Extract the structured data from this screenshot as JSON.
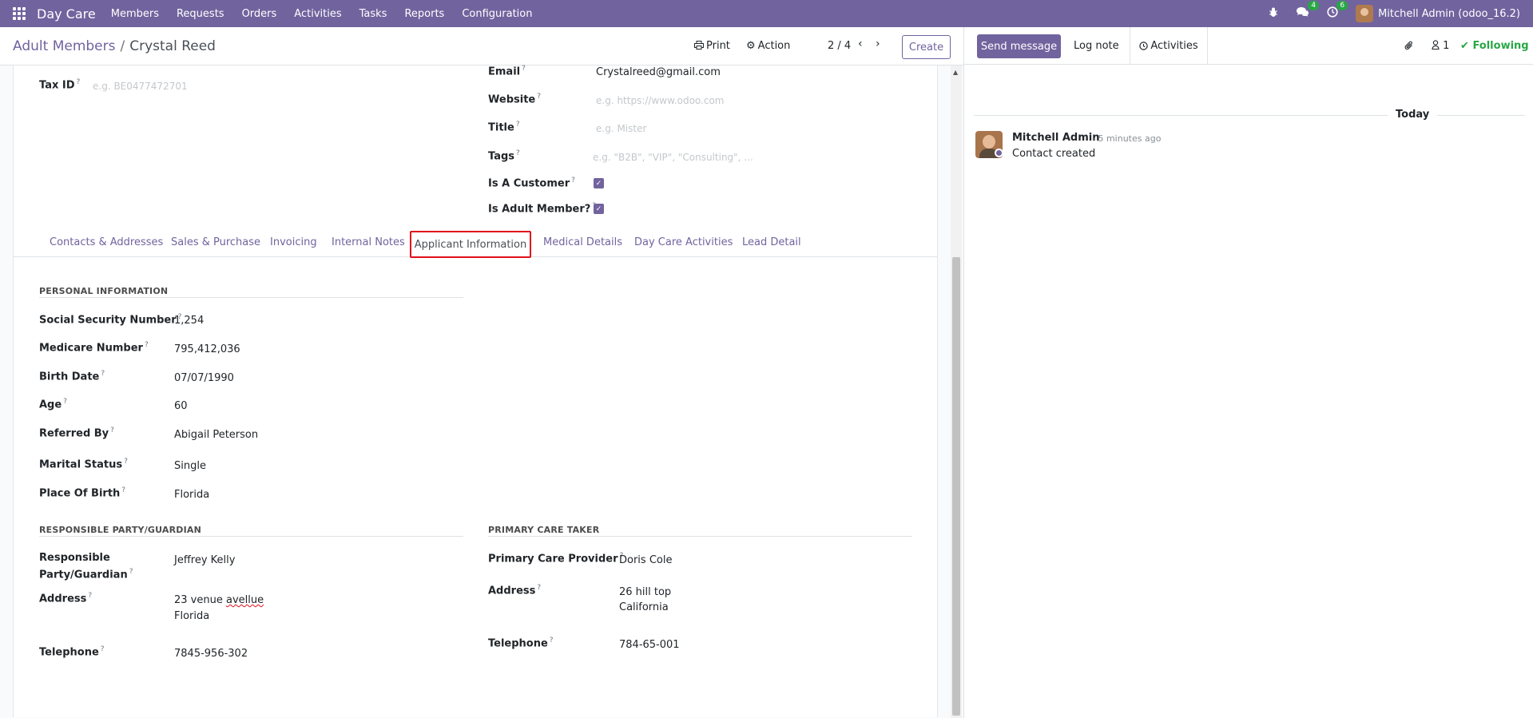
{
  "navbar": {
    "brand": "Day Care",
    "menu": [
      "Members",
      "Requests",
      "Orders",
      "Activities",
      "Tasks",
      "Reports",
      "Configuration"
    ],
    "messages_count": "4",
    "activities_count": "6",
    "user": "Mitchell Admin (odoo_16.2)",
    "brand_color": "#71639e"
  },
  "control_panel": {
    "breadcrumb_parent": "Adult Members",
    "breadcrumb_sep": "/",
    "breadcrumb_current": "Crystal Reed",
    "print_label": "Print",
    "action_label": "Action",
    "pager": "2 / 4",
    "create_label": "Create"
  },
  "header_fields": {
    "tax_id_label": "Tax ID",
    "tax_id_placeholder": "e.g. BE0477472701",
    "email_label": "Email",
    "email_value": "Crystalreed@gmail.com",
    "website_label": "Website",
    "website_placeholder": "e.g. https://www.odoo.com",
    "title_label": "Title",
    "title_placeholder": "e.g. Mister",
    "tags_label": "Tags",
    "tags_placeholder": "e.g. \"B2B\", \"VIP\", \"Consulting\", ...",
    "customer_label": "Is A Customer",
    "customer_checked": true,
    "adult_member_label": "Is Adult Member?",
    "adult_member_checked": true
  },
  "tabs": {
    "items": [
      "Contacts & Addresses",
      "Sales & Purchase",
      "Invoicing",
      "Internal Notes",
      "Applicant Information",
      "Medical Details",
      "Day Care Activities",
      "Lead Detail"
    ],
    "active": "Applicant Information"
  },
  "personal": {
    "title": "PERSONAL INFORMATION",
    "ssn_label": "Social Security Number",
    "ssn": "1,254",
    "medicare_label": "Medicare Number",
    "medicare": "795,412,036",
    "birth_label": "Birth Date",
    "birth": "07/07/1990",
    "age_label": "Age",
    "age": "60",
    "referred_label": "Referred By",
    "referred": "Abigail Peterson",
    "marital_label": "Marital Status",
    "marital": "Single",
    "pob_label": "Place Of Birth",
    "pob": "Florida"
  },
  "guardian": {
    "title": "RESPONSIBLE PARTY/GUARDIAN",
    "responsible_label_1": "Responsible",
    "responsible_label_2": "Party/Guardian",
    "responsible": "Jeffrey Kelly",
    "address_label": "Address",
    "address_line1_a": "23 venue ",
    "address_line1_b": "avellue",
    "address_line2": "Florida",
    "telephone_label": "Telephone",
    "telephone": "7845-956-302"
  },
  "caretaker": {
    "title": "PRIMARY CARE TAKER",
    "provider_label": "Primary Care Provider",
    "provider": "Doris Cole",
    "address_label": "Address",
    "address_line1": "26 hill top",
    "address_line2": "California",
    "telephone_label": "Telephone",
    "telephone": "784-65-001"
  },
  "chatter": {
    "send_message": "Send message",
    "log_note": "Log note",
    "activities": "Activities",
    "followers_count": "1",
    "following": "Following",
    "date_separator": "Today",
    "messages": [
      {
        "author": "Mitchell Admin",
        "time": "- 5 minutes ago",
        "body": "Contact created"
      }
    ]
  }
}
